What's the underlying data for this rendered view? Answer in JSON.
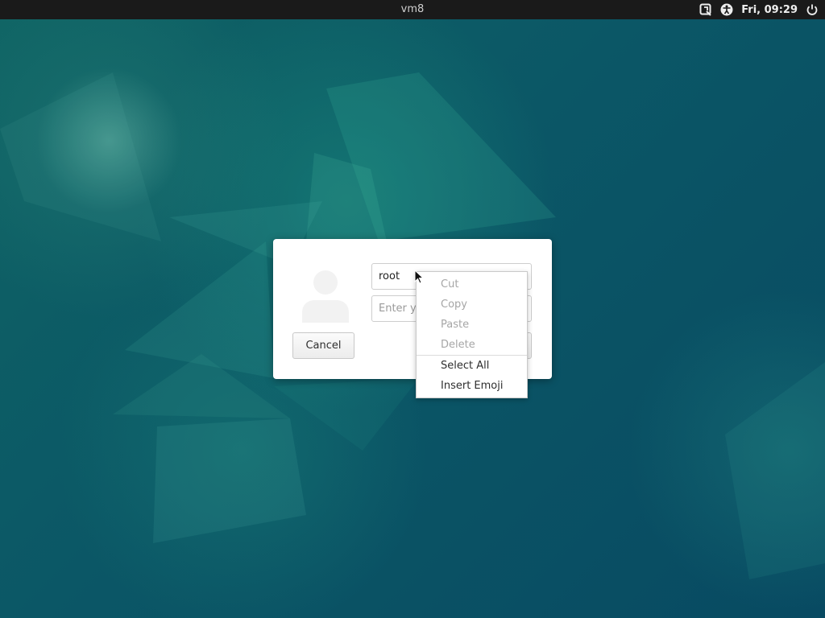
{
  "topbar": {
    "title": "vm8",
    "clock": "Fri, 09:29",
    "icons": [
      "screen-keyboard-icon",
      "accessibility-icon",
      "power-icon"
    ]
  },
  "dialog": {
    "username_value": "root",
    "password_placeholder": "Enter y",
    "cancel_label": "Cancel"
  },
  "context_menu": {
    "items": [
      {
        "label": "Cut",
        "enabled": false
      },
      {
        "label": "Copy",
        "enabled": false
      },
      {
        "label": "Paste",
        "enabled": false
      },
      {
        "label": "Delete",
        "enabled": false
      },
      {
        "label": "Select All",
        "enabled": true
      },
      {
        "label": "Insert Emoji",
        "enabled": true
      }
    ]
  },
  "colors": {
    "topbar_bg": "#1a1a1a",
    "wallpaper_teal": "#0b5766",
    "disabled_text": "#a6a6a6"
  }
}
